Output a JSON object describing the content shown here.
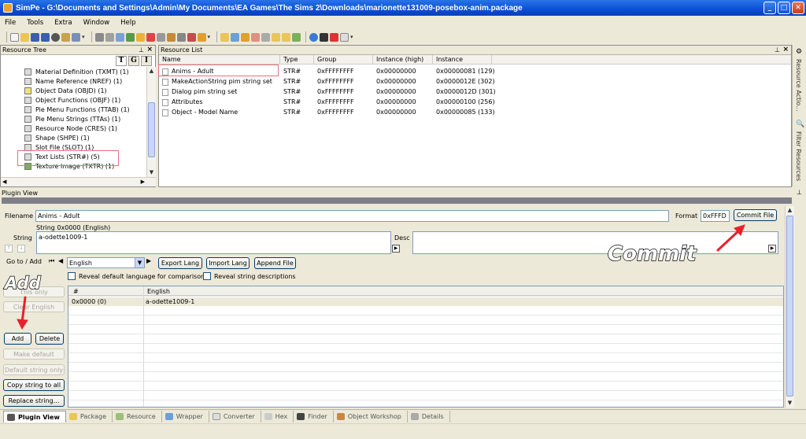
{
  "window": {
    "title": "SimPe - G:\\Documents and Settings\\Admin\\My Documents\\EA Games\\The Sims 2\\Downloads\\marionette131009-posebox-anim.package",
    "minimize": "_",
    "maximize": "□",
    "close": "✕"
  },
  "menu": [
    "File",
    "Tools",
    "Extra",
    "Window",
    "Help"
  ],
  "resource_tree": {
    "title": "Resource Tree",
    "tabs": [
      "T",
      "G",
      "I"
    ],
    "items": [
      "Material Definition (TXMT) (1)",
      "Name Reference (NREF) (1)",
      "Object Data (OBJD) (1)",
      "Object Functions (OBJF) (1)",
      "Pie Menu Functions (TTAB) (1)",
      "Pie Menu Strings (TTAs) (1)",
      "Resource Node (CRES) (1)",
      "Shape (SHPE) (1)",
      "Slot File (SLOT) (1)",
      "Text Lists (STR#) (5)",
      "Texture Image (TXTR) (1)"
    ]
  },
  "resource_list": {
    "title": "Resource List",
    "columns": [
      "Name",
      "Type",
      "Group",
      "Instance (high)",
      "Instance"
    ],
    "rows": [
      [
        "Anims - Adult",
        "STR#",
        "0xFFFFFFFF",
        "0x00000000",
        "0x00000081 (129)"
      ],
      [
        "MakeActionString pim string set",
        "STR#",
        "0xFFFFFFFF",
        "0x00000000",
        "0x0000012E (302)"
      ],
      [
        "Dialog pim string set",
        "STR#",
        "0xFFFFFFFF",
        "0x00000000",
        "0x0000012D (301)"
      ],
      [
        "Attributes",
        "STR#",
        "0xFFFFFFFF",
        "0x00000000",
        "0x00000100 (256)"
      ],
      [
        "Object - Model Name",
        "STR#",
        "0xFFFFFFFF",
        "0x00000000",
        "0x00000085 (133)"
      ]
    ]
  },
  "side_panels": [
    "Resource Actio...",
    "Filter Resources"
  ],
  "plugin_view": {
    "title": "Plugin View",
    "filename_label": "Filename",
    "filename_value": "Anims - Adult",
    "format_label": "Format",
    "format_value": "0xFFFD",
    "commit_file": "Commit File",
    "string_label": "String",
    "string_header": "String 0x0000 (English)",
    "string_value": "a-odette1009-1",
    "desc_label": "Desc",
    "goto_label": "Go to / Add",
    "language": "English",
    "export_lang": "Export Lang",
    "import_lang": "Import Lang",
    "append_file": "Append File",
    "reveal_default": "Reveal default language for comparison",
    "reveal_desc": "Reveal string descriptions",
    "btn_this_only": "This only",
    "btn_clear_english": "Clear English",
    "btn_add": "Add",
    "btn_delete": "Delete",
    "btn_make_default": "Make default",
    "btn_default_string_only": "Default string only",
    "btn_copy_string_to_all": "Copy string to all",
    "btn_replace_string": "Replace string...",
    "grid_columns": [
      "#",
      "English"
    ],
    "grid_rows": [
      [
        "0x0000 (0)",
        "a-odette1009-1"
      ]
    ]
  },
  "bottom_tabs": [
    "Plugin View",
    "Package",
    "Resource",
    "Wrapper",
    "Converter",
    "Hex",
    "Finder",
    "Object Workshop",
    "Details"
  ],
  "annotations": {
    "add": "Add",
    "commit": "Commit"
  },
  "colors": {
    "highlight_box": "#e8707c",
    "arrow": "#e8202a",
    "titlebar": "#0a4fd3"
  }
}
